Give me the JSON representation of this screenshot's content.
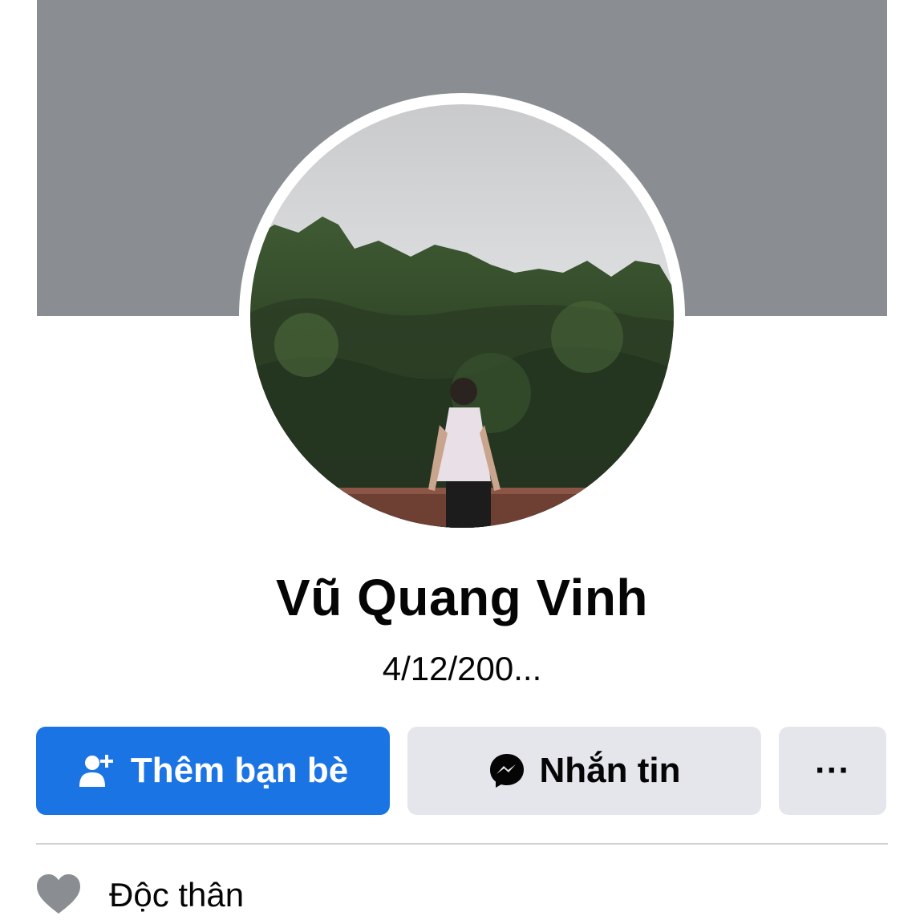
{
  "profile": {
    "name": "Vũ Quang Vinh",
    "subtitle": "4/12/200..."
  },
  "actions": {
    "add_friend_label": "Thêm bạn bè",
    "message_label": "Nhắn tin",
    "more_label": "···"
  },
  "details": [
    {
      "icon": "heart-icon",
      "label": "Độc thân"
    }
  ],
  "colors": {
    "primary": "#1b74e4",
    "secondary_button": "#e4e6eb",
    "cover_placeholder": "#8a8d91",
    "text": "#050505",
    "divider": "#ced0d4"
  }
}
